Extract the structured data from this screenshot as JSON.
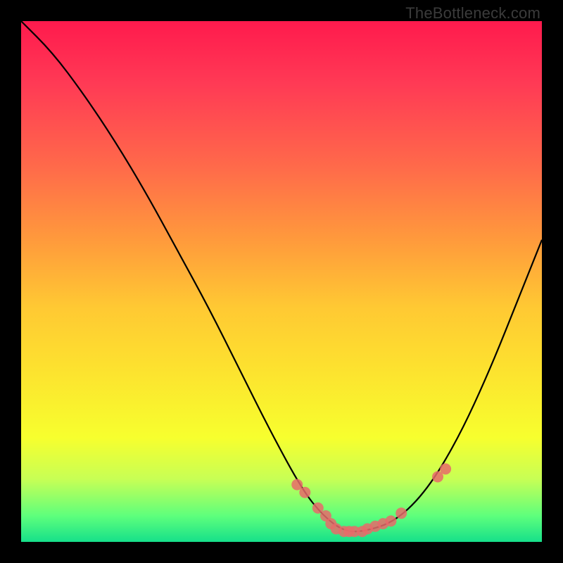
{
  "attribution": "TheBottleneck.com",
  "chart_data": {
    "type": "line",
    "title": "",
    "xlabel": "",
    "ylabel": "",
    "xlim": [
      0,
      100
    ],
    "ylim": [
      0,
      100
    ],
    "curve": {
      "x": [
        0,
        6,
        12,
        18,
        24,
        30,
        36,
        42,
        48,
        54,
        58,
        62,
        66,
        72,
        78,
        84,
        90,
        96,
        100
      ],
      "y": [
        100,
        94,
        86,
        77,
        67,
        56,
        45,
        33,
        21,
        10,
        5,
        2,
        2,
        4,
        10,
        20,
        33,
        48,
        58
      ]
    },
    "points": {
      "x": [
        53,
        54.5,
        57,
        58.5,
        59.5,
        60.5,
        62,
        63,
        64,
        65.5,
        66.5,
        68,
        69.5,
        71,
        73,
        80,
        81.5
      ],
      "y": [
        11,
        9.5,
        6.5,
        5,
        3.5,
        2.5,
        2,
        2,
        2,
        2,
        2.5,
        3,
        3.5,
        4,
        5.5,
        12.5,
        14
      ]
    }
  }
}
